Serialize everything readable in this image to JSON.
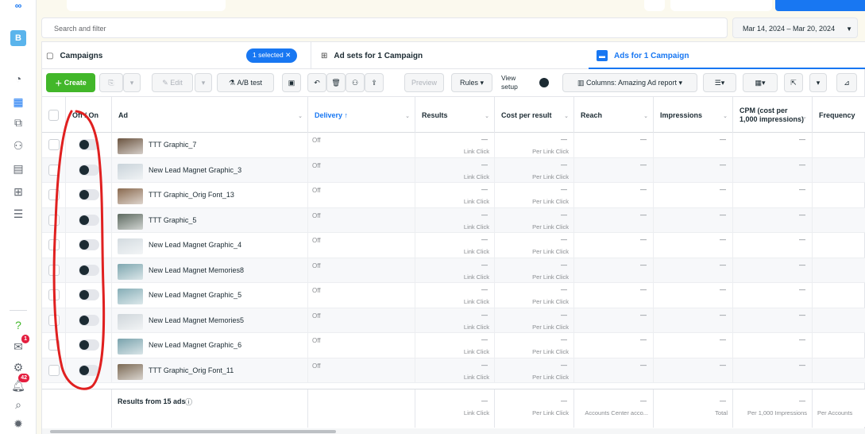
{
  "rail": {
    "account_initial": "B",
    "help_glyph": "?",
    "notif_badge_1": "1",
    "notif_badge_2": "42"
  },
  "search": {
    "placeholder": "Search and filter"
  },
  "date_range": "Mar 14, 2024 – Mar 20, 2024",
  "tabs": {
    "campaigns": "Campaigns",
    "selected_pill": "1 selected",
    "ad_sets": "Ad sets for 1 Campaign",
    "ads": "Ads for 1 Campaign"
  },
  "toolbar": {
    "create": "Create",
    "edit": "Edit",
    "ab_test": "A/B test",
    "preview": "Preview",
    "rules": "Rules",
    "view_setup": "View setup",
    "columns": "Columns: Amazing Ad report"
  },
  "columns": {
    "off_on": "Off / On",
    "ad": "Ad",
    "delivery": "Delivery ↑",
    "results": "Results",
    "cost_per_result": "Cost per result",
    "reach": "Reach",
    "impressions": "Impressions",
    "cpm": "CPM (cost per 1,000 impressions)",
    "frequency": "Frequency"
  },
  "rows": [
    {
      "name": "TTT Graphic_7",
      "delivery": "Off",
      "results": "—",
      "results_sub": "Link Click",
      "cpr": "—",
      "cpr_sub": "Per Link Click",
      "reach": "—",
      "impressions": "—",
      "cpm": "—",
      "thumb": "#6b5440"
    },
    {
      "name": "New Lead Magnet Graphic_3",
      "delivery": "Off",
      "results": "—",
      "results_sub": "Link Click",
      "cpr": "—",
      "cpr_sub": "Per Link Click",
      "reach": "—",
      "impressions": "—",
      "cpm": "—",
      "thumb": "#c9d3da"
    },
    {
      "name": "TTT Graphic_Orig Font_13",
      "delivery": "Off",
      "results": "—",
      "results_sub": "Link Click",
      "cpr": "—",
      "cpr_sub": "Per Link Click",
      "reach": "—",
      "impressions": "—",
      "cpm": "—",
      "thumb": "#8a6a4f"
    },
    {
      "name": "TTT Graphic_5",
      "delivery": "Off",
      "results": "—",
      "results_sub": "Link Click",
      "cpr": "—",
      "cpr_sub": "Per Link Click",
      "reach": "—",
      "impressions": "—",
      "cpm": "—",
      "thumb": "#5d6a60"
    },
    {
      "name": "New Lead Magnet Graphic_4",
      "delivery": "Off",
      "results": "—",
      "results_sub": "Link Click",
      "cpr": "—",
      "cpr_sub": "Per Link Click",
      "reach": "—",
      "impressions": "—",
      "cpm": "—",
      "thumb": "#d3dbe0"
    },
    {
      "name": "New Lead Magnet Memories8",
      "delivery": "Off",
      "results": "—",
      "results_sub": "Link Click",
      "cpr": "—",
      "cpr_sub": "Per Link Click",
      "reach": "—",
      "impressions": "—",
      "cpm": "—",
      "thumb": "#7fa7b0"
    },
    {
      "name": "New Lead Magnet Graphic_5",
      "delivery": "Off",
      "results": "—",
      "results_sub": "Link Click",
      "cpr": "—",
      "cpr_sub": "Per Link Click",
      "reach": "—",
      "impressions": "—",
      "cpm": "—",
      "thumb": "#86aeb7"
    },
    {
      "name": "New Lead Magnet Memories5",
      "delivery": "Off",
      "results": "—",
      "results_sub": "Link Click",
      "cpr": "—",
      "cpr_sub": "Per Link Click",
      "reach": "—",
      "impressions": "—",
      "cpm": "—",
      "thumb": "#cfd6db"
    },
    {
      "name": "New Lead Magnet Graphic_6",
      "delivery": "Off",
      "results": "—",
      "results_sub": "Link Click",
      "cpr": "—",
      "cpr_sub": "Per Link Click",
      "reach": "—",
      "impressions": "—",
      "cpm": "—",
      "thumb": "#7aa3ad"
    },
    {
      "name": "TTT Graphic_Orig Font_11",
      "delivery": "Off",
      "results": "—",
      "results_sub": "Link Click",
      "cpr": "—",
      "cpr_sub": "Per Link Click",
      "reach": "—",
      "impressions": "—",
      "cpm": "—",
      "thumb": "#7c6a55"
    }
  ],
  "footer": {
    "label": "Results from 15 ads",
    "results": "—",
    "results_sub": "Link Click",
    "cpr": "—",
    "cpr_sub": "Per Link Click",
    "reach": "—",
    "reach_sub": "Accounts Center acco...",
    "impressions": "—",
    "impressions_sub": "Total",
    "cpm": "—",
    "cpm_sub": "Per 1,000 Impressions",
    "freq_sub": "Per Accounts"
  },
  "colors": {
    "accent": "#1877f2",
    "create": "#42b72a",
    "annotation": "#e02020"
  }
}
